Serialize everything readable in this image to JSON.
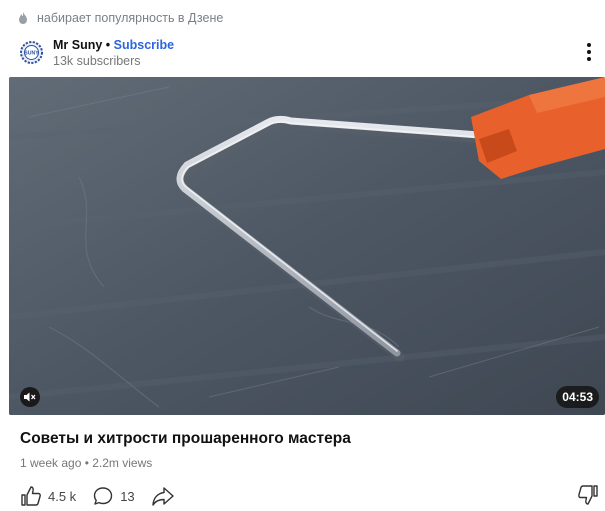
{
  "trending": {
    "text": "набирает популярность в Дзене",
    "icon": "flame-icon"
  },
  "channel": {
    "name": "Mr Suny",
    "separator": "•",
    "subscribe_label": "Subscribe",
    "subscribers": "13k subscribers",
    "avatar_text": "SUNY",
    "more_icon": "more-vertical-icon"
  },
  "video": {
    "duration": "04:53",
    "mute_icon": "mute-icon"
  },
  "post": {
    "title": "Советы и хитрости прошаренного мастера",
    "meta": "1 week ago • 2.2m views"
  },
  "actions": {
    "likes": "4.5 k",
    "comments": "13",
    "like_icon": "thumbs-up-icon",
    "comment_icon": "comment-icon",
    "share_icon": "share-icon",
    "dislike_icon": "thumbs-down-icon"
  },
  "colors": {
    "accent": "#2b66e0",
    "handle": "#e8612c"
  }
}
